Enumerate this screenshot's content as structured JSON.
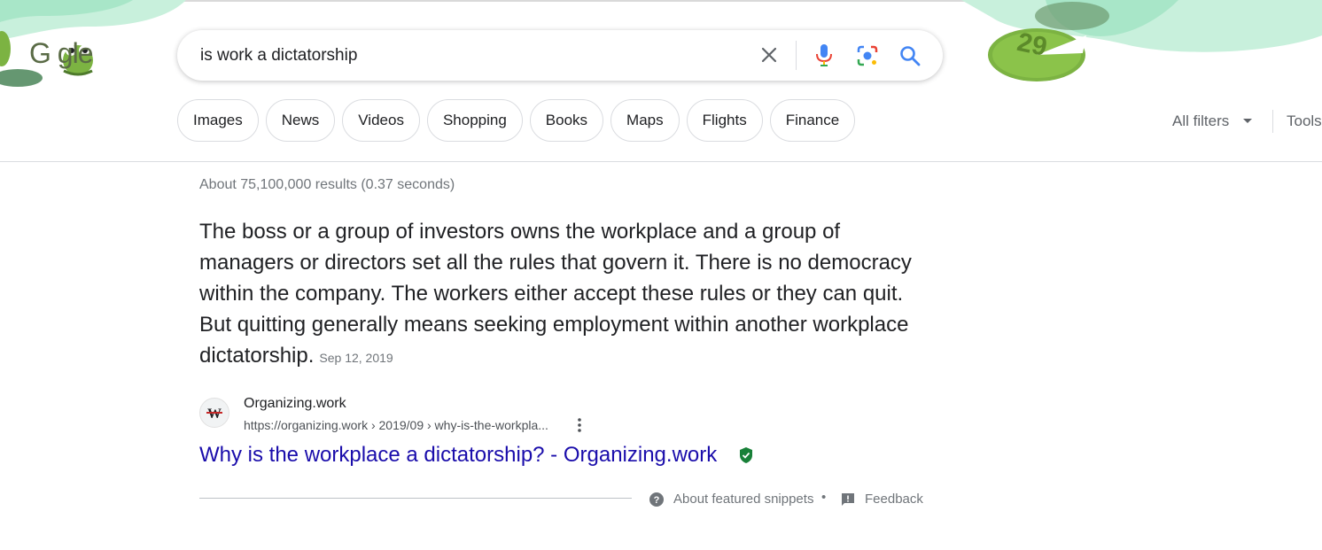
{
  "search": {
    "query": "is work a dictatorship"
  },
  "logo": {
    "text": "G  gle",
    "doodle_number": "29"
  },
  "filters": {
    "chips": [
      "Images",
      "News",
      "Videos",
      "Shopping",
      "Books",
      "Maps",
      "Flights",
      "Finance"
    ],
    "all_filters_label": "All filters",
    "tools_label": "Tools"
  },
  "results": {
    "stats": "About 75,100,000 results (0.37 seconds)",
    "snippet": {
      "text": "The boss or a group of investors owns the workplace and a group of managers or directors set all the rules that govern it. There is no democracy within the company. The workers either accept these rules or they can quit. But quitting generally means seeking employment within another workplace dictatorship.",
      "date": "Sep 12, 2019"
    },
    "source": {
      "favicon_letter": "W",
      "site_name": "Organizing.work",
      "url": "https://organizing.work › 2019/09 › why-is-the-workpla...",
      "title": "Why is the workplace a dictatorship? - Organizing.work"
    },
    "footer": {
      "about_label": "About featured snippets",
      "separator": "•",
      "feedback_label": "Feedback"
    }
  },
  "colors": {
    "link": "#1a0dab",
    "doodle_green": "#7cb342",
    "doodle_water": "#a8e6c8",
    "muted_text": "#70757a"
  }
}
